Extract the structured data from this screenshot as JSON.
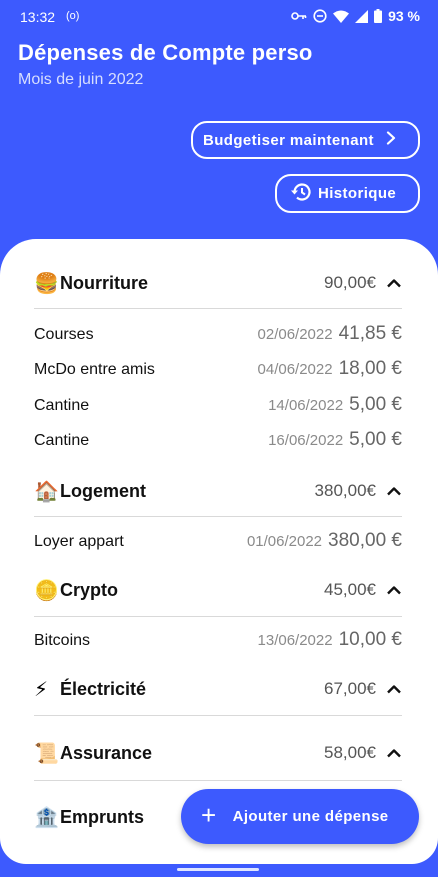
{
  "status_bar": {
    "time": "13:32",
    "radio_indicator": "(o)",
    "battery": "93 %",
    "icons": [
      "key-icon",
      "do-not-disturb-icon",
      "wifi-icon",
      "signal-icon",
      "battery-icon"
    ]
  },
  "header": {
    "title": "Dépenses de Compte perso",
    "subtitle": "Mois de juin 2022"
  },
  "actions": {
    "budget_label": "Budgetiser maintenant",
    "history_label": "Historique"
  },
  "categories": [
    {
      "emoji": "🍔",
      "name": "Nourriture",
      "total": "90,00€",
      "expenses": [
        {
          "name": "Courses",
          "date": "02/06/2022",
          "amount": "41,85 €"
        },
        {
          "name": "McDo entre amis",
          "date": "04/06/2022",
          "amount": "18,00 €"
        },
        {
          "name": "Cantine",
          "date": "14/06/2022",
          "amount": "5,00 €"
        },
        {
          "name": "Cantine",
          "date": "16/06/2022",
          "amount": "5,00 €"
        }
      ]
    },
    {
      "emoji": "🏠",
      "name": "Logement",
      "total": "380,00€",
      "expenses": [
        {
          "name": "Loyer appart",
          "date": "01/06/2022",
          "amount": "380,00 €"
        }
      ]
    },
    {
      "emoji": "🪙",
      "name": "Crypto",
      "total": "45,00€",
      "expenses": [
        {
          "name": "Bitcoins",
          "date": "13/06/2022",
          "amount": "10,00 €"
        }
      ]
    },
    {
      "emoji": "⚡",
      "name": "Électricité",
      "total": "67,00€",
      "expenses": []
    },
    {
      "emoji": "📜",
      "name": "Assurance",
      "total": "58,00€",
      "expenses": []
    },
    {
      "emoji": "🏦",
      "name": "Emprunts",
      "total": "",
      "expenses": []
    }
  ],
  "fab": {
    "icon": "+",
    "label": "Ajouter une dépense"
  },
  "colors": {
    "primary": "#3d5afe",
    "card": "#ffffff"
  }
}
